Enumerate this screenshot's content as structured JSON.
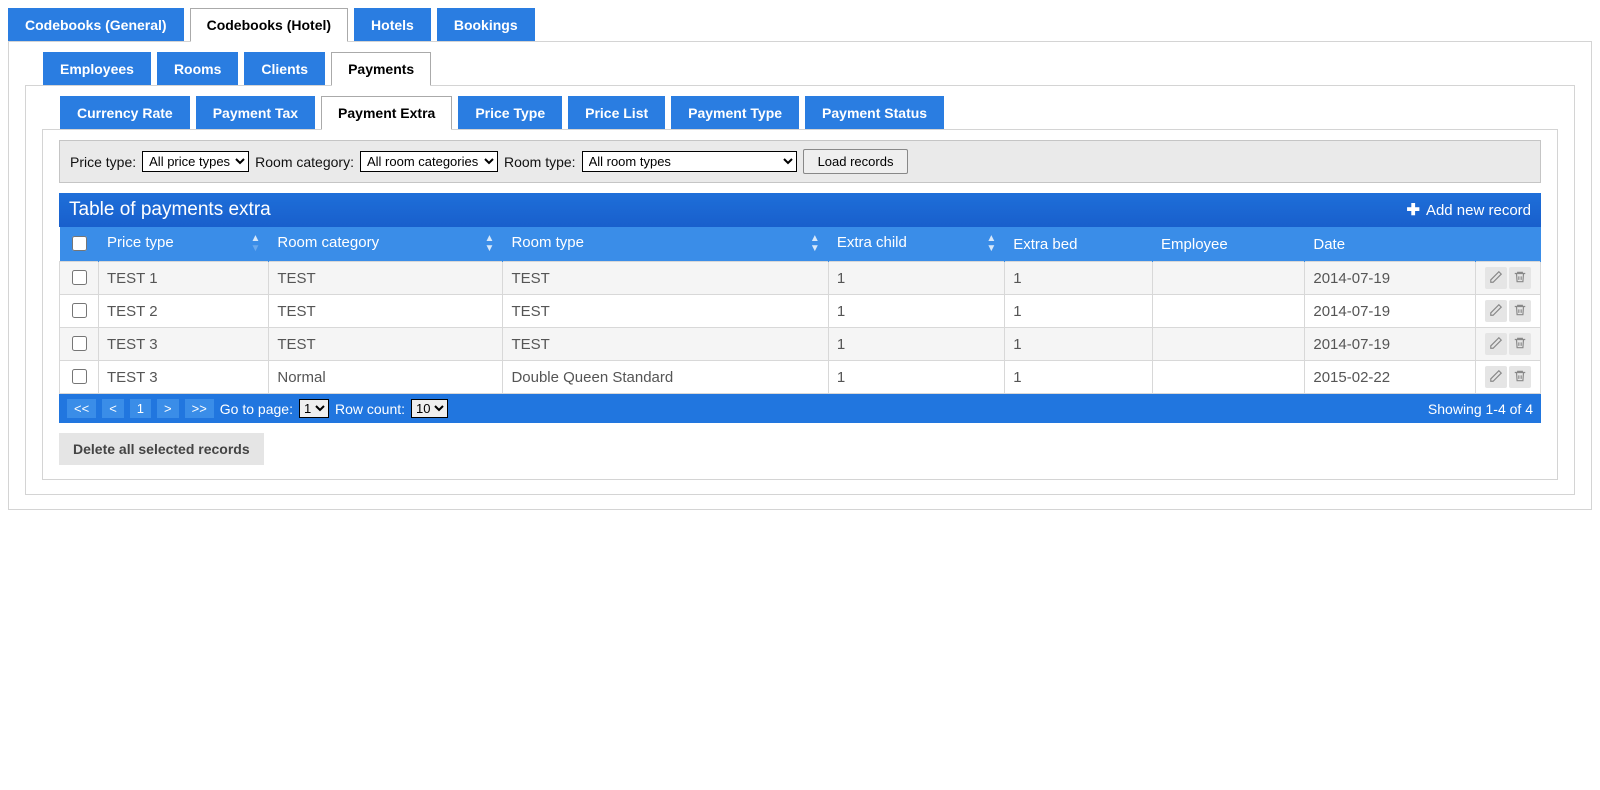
{
  "top_tabs": [
    {
      "label": "Codebooks (General)",
      "active": false
    },
    {
      "label": "Codebooks (Hotel)",
      "active": true
    },
    {
      "label": "Hotels",
      "active": false
    },
    {
      "label": "Bookings",
      "active": false
    }
  ],
  "sub_tabs": [
    {
      "label": "Employees",
      "active": false
    },
    {
      "label": "Rooms",
      "active": false
    },
    {
      "label": "Clients",
      "active": false
    },
    {
      "label": "Payments",
      "active": true
    }
  ],
  "payment_tabs": [
    {
      "label": "Currency Rate",
      "active": false
    },
    {
      "label": "Payment Tax",
      "active": false
    },
    {
      "label": "Payment Extra",
      "active": true
    },
    {
      "label": "Price Type",
      "active": false
    },
    {
      "label": "Price List",
      "active": false
    },
    {
      "label": "Payment Type",
      "active": false
    },
    {
      "label": "Payment Status",
      "active": false
    }
  ],
  "filters": {
    "price_type_label": "Price type:",
    "price_type_value": "All price types",
    "room_category_label": "Room category:",
    "room_category_value": "All room categories",
    "room_type_label": "Room type:",
    "room_type_value": "All room types",
    "load_button": "Load records"
  },
  "table": {
    "title": "Table of payments extra",
    "add_label": "Add new record",
    "columns": [
      "Price type",
      "Room category",
      "Room type",
      "Extra child",
      "Extra bed",
      "Employee",
      "Date"
    ],
    "sort_column": "Price type",
    "sort_dir": "asc",
    "rows": [
      {
        "price_type": "TEST 1",
        "room_category": "TEST",
        "room_type": "TEST",
        "extra_child": "1",
        "extra_bed": "1",
        "employee": "",
        "date": "2014-07-19"
      },
      {
        "price_type": "TEST 2",
        "room_category": "TEST",
        "room_type": "TEST",
        "extra_child": "1",
        "extra_bed": "1",
        "employee": "",
        "date": "2014-07-19"
      },
      {
        "price_type": "TEST 3",
        "room_category": "TEST",
        "room_type": "TEST",
        "extra_child": "1",
        "extra_bed": "1",
        "employee": "",
        "date": "2014-07-19"
      },
      {
        "price_type": "TEST 3",
        "room_category": "Normal",
        "room_type": "Double Queen Standard",
        "extra_child": "1",
        "extra_bed": "1",
        "employee": "",
        "date": "2015-02-22"
      }
    ]
  },
  "pager": {
    "first": "<<",
    "prev": "<",
    "current_page": "1",
    "next": ">",
    "last": ">>",
    "goto_label": "Go to page:",
    "goto_value": "1",
    "rowcount_label": "Row count:",
    "rowcount_value": "10",
    "showing": "Showing 1-4 of 4"
  },
  "delete_all": "Delete all selected records"
}
